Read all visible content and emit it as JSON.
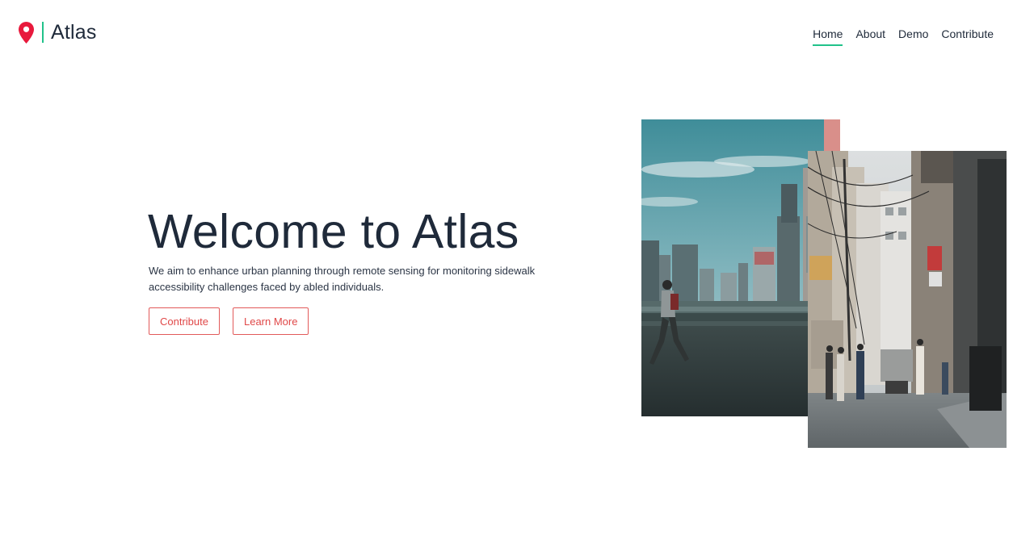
{
  "brand": {
    "name": "Atlas",
    "accent_color": "#21c28a",
    "pin_color": "#e8193c",
    "icon": "map-pin-icon"
  },
  "nav": {
    "items": [
      {
        "label": "Home",
        "active": true
      },
      {
        "label": "About",
        "active": false
      },
      {
        "label": "Demo",
        "active": false
      },
      {
        "label": "Contribute",
        "active": false
      }
    ]
  },
  "hero": {
    "title": "Welcome to Atlas",
    "description": "We aim to enhance urban planning through remote sensing for monitoring sidewalk accessibility challenges faced by abled individuals.",
    "buttons": {
      "contribute_label": "Contribute",
      "learn_more_label": "Learn More"
    },
    "button_color": "#e04848"
  },
  "images": {
    "back": "city-overpass-photo",
    "front": "busy-street-photo"
  }
}
